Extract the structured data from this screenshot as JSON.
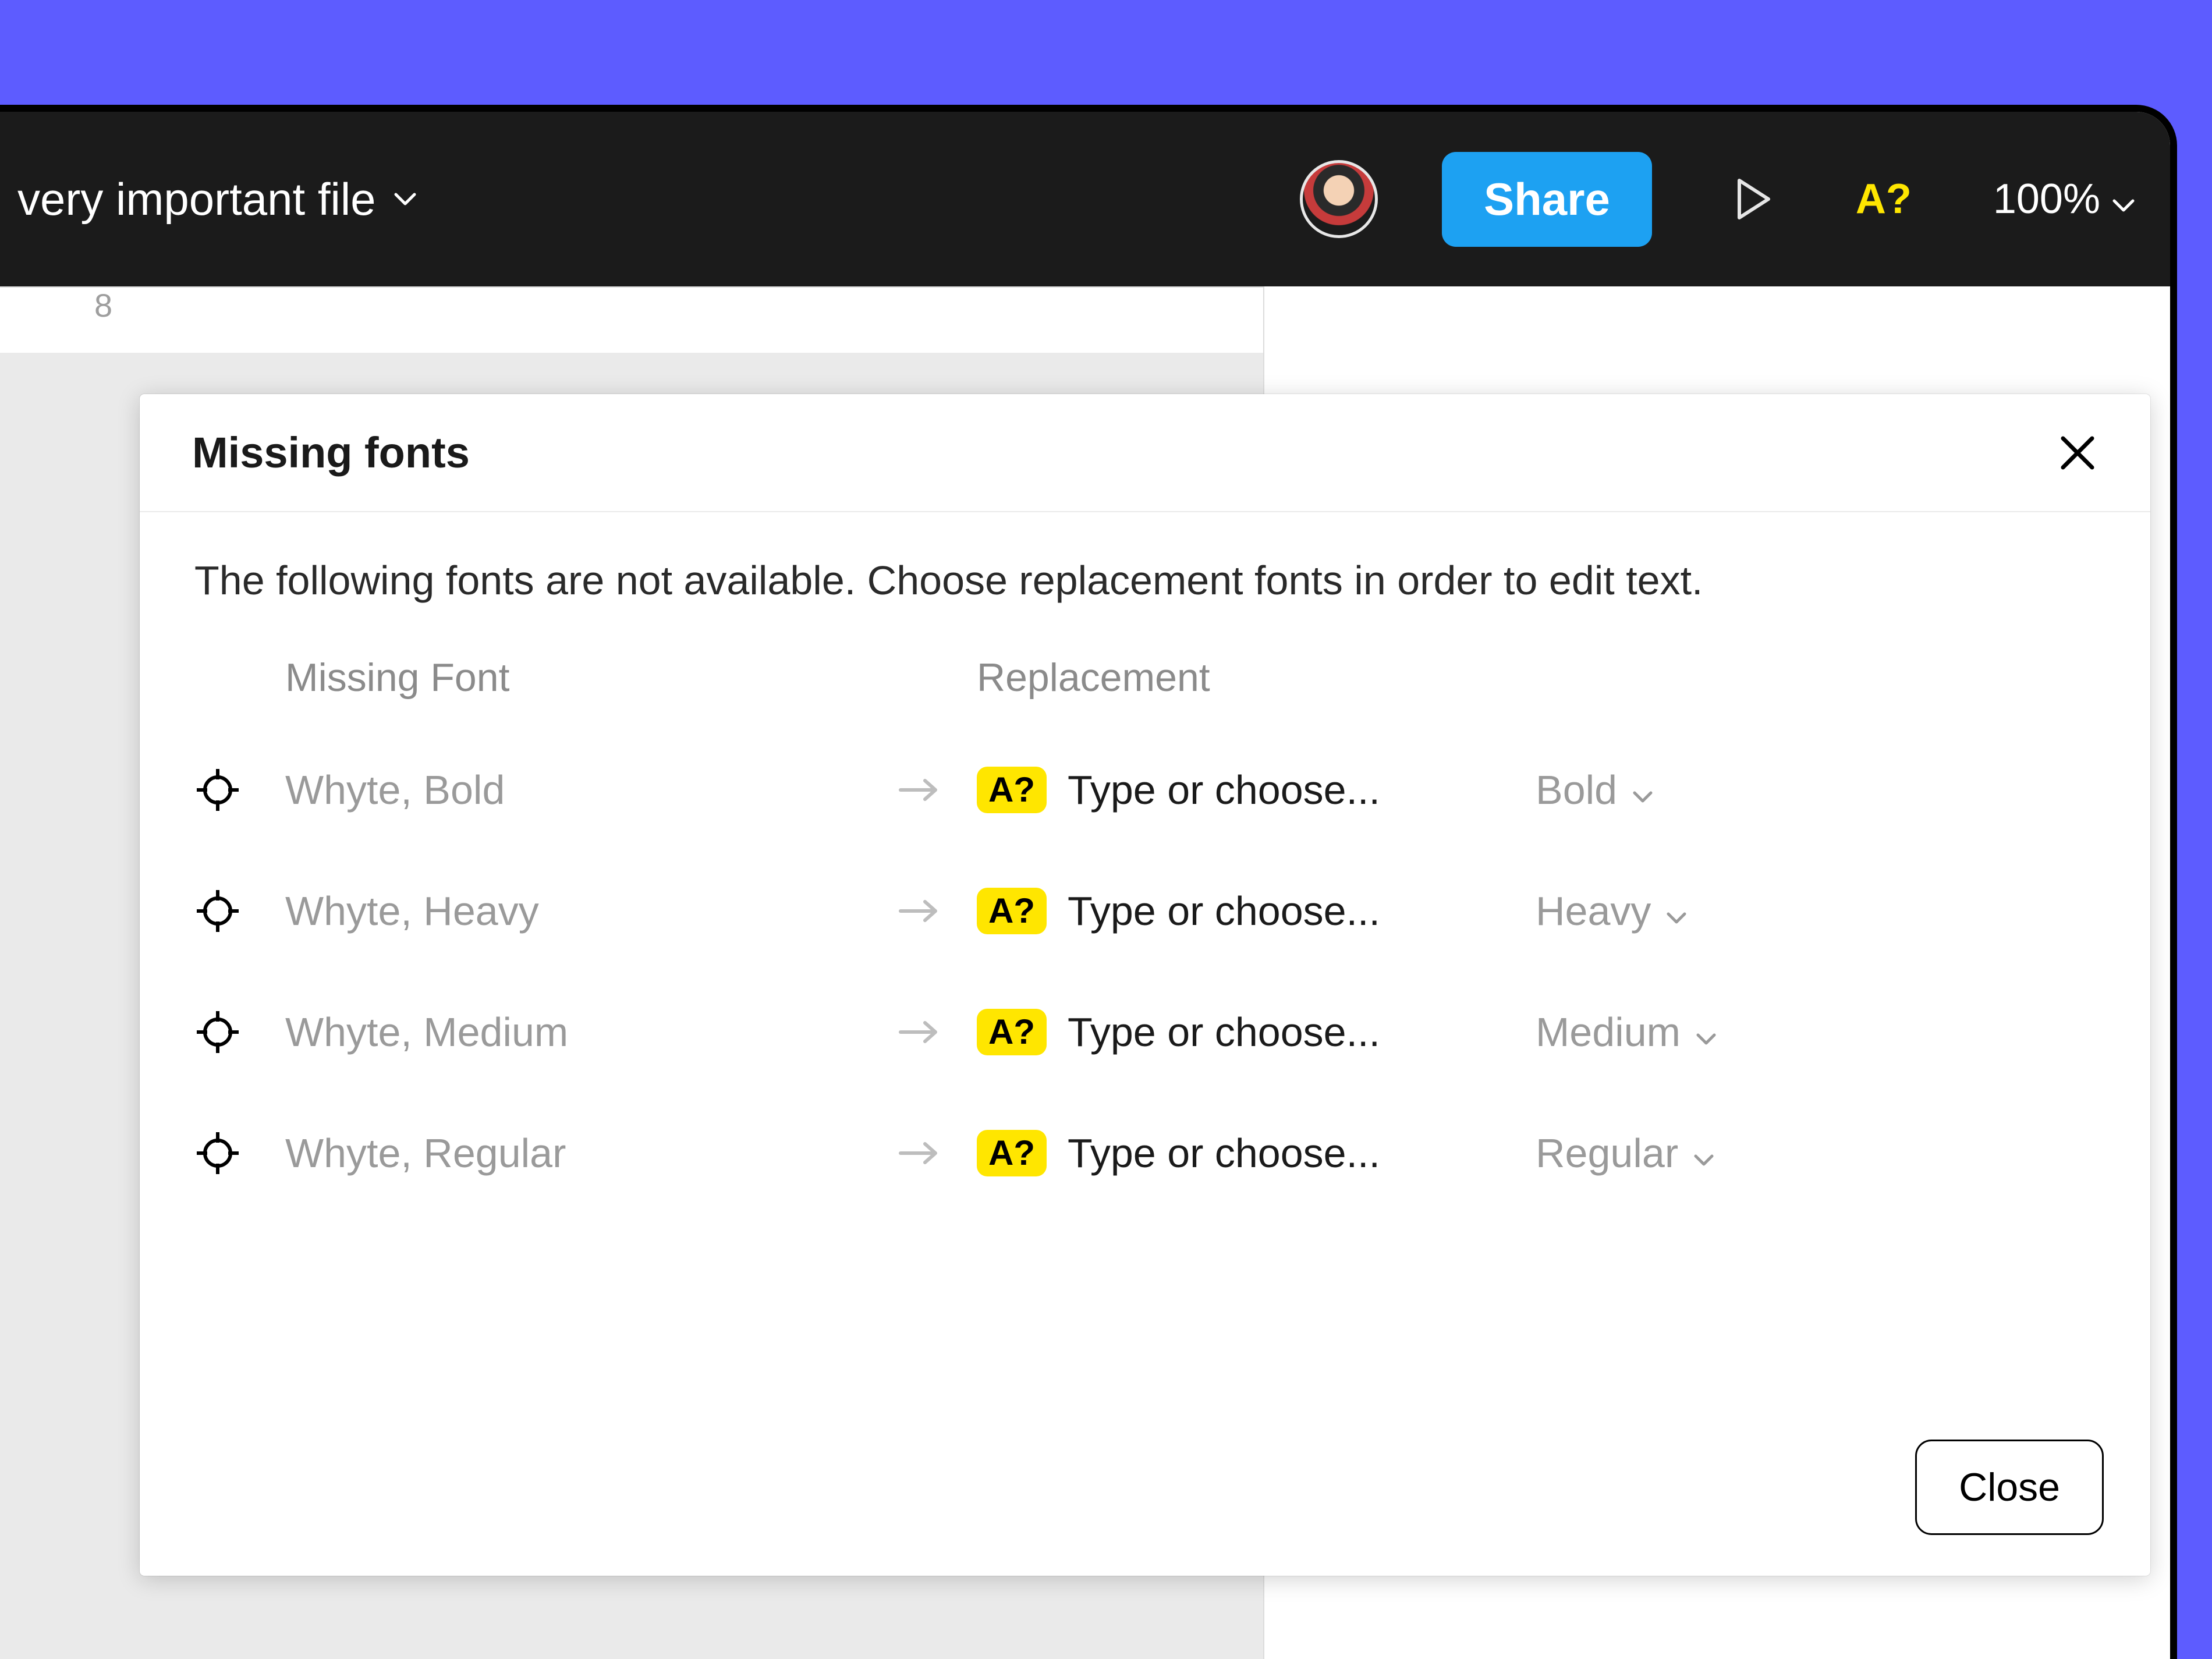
{
  "toolbar": {
    "file_name": "very important file",
    "share_label": "Share",
    "missing_fonts_badge": "A?",
    "zoom_label": "100%"
  },
  "canvas": {
    "ruler_number": "8"
  },
  "dialog": {
    "title": "Missing fonts",
    "description": "The following fonts are not available. Choose replacement fonts in order to edit text.",
    "headers": {
      "missing": "Missing Font",
      "replacement": "Replacement"
    },
    "replacement_placeholder": "Type or choose...",
    "badge_label": "A?",
    "rows": [
      {
        "missing": "Whyte, Bold",
        "weight": "Bold"
      },
      {
        "missing": "Whyte, Heavy",
        "weight": "Heavy"
      },
      {
        "missing": "Whyte, Medium",
        "weight": "Medium"
      },
      {
        "missing": "Whyte, Regular",
        "weight": "Regular"
      }
    ],
    "close_label": "Close"
  },
  "colors": {
    "page_background": "#5d5cff",
    "toolbar_background": "#1b1b1b",
    "share_button": "#1da1f2",
    "warning_yellow": "#ffe600"
  }
}
